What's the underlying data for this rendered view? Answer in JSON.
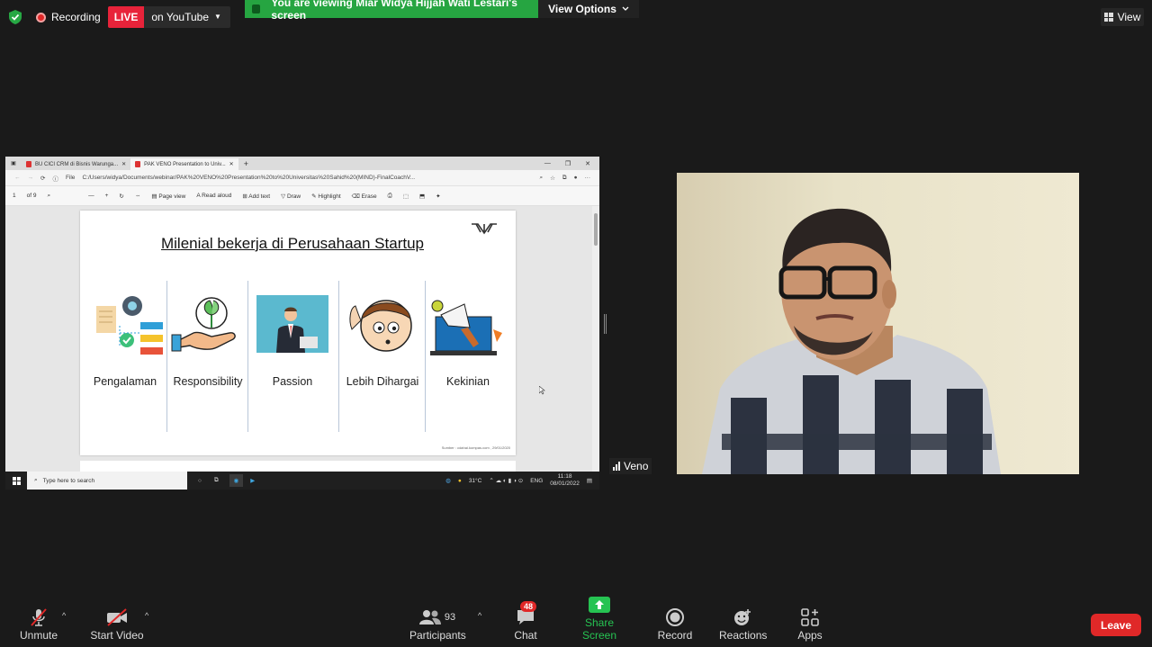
{
  "top": {
    "recording_label": "Recording",
    "live_label": "LIVE",
    "youtube_label": "on YouTube",
    "viewing_banner": "You are viewing Miar Widya Hijjah Wati Lestari's screen",
    "view_options_label": "View Options",
    "view_label": "View"
  },
  "browser": {
    "tabs": [
      {
        "label": "BU CICI CRM di Bisnis Warunga..."
      },
      {
        "label": "PAK VENO Presentation to Univ..."
      }
    ],
    "address_prefix": "File",
    "url": "C:/Users/widya/Documents/webinar/PAK%20VENO%20Presentation%20to%20Universitas%20Sahid%20(MIND)-FinalCoachV...",
    "page_number": "1",
    "page_total": "of 9",
    "toolbar": {
      "page_view": "Page view",
      "read_aloud": "Read aloud",
      "add_text": "Add text",
      "draw": "Draw",
      "highlight": "Highlight",
      "erase": "Erase"
    }
  },
  "slide": {
    "title": "Milenial bekerja di Perusahaan Startup",
    "items": [
      {
        "label": "Pengalaman"
      },
      {
        "label": "Responsibility"
      },
      {
        "label": "Passion"
      },
      {
        "label": "Lebih Dihargai"
      },
      {
        "label": "Kekinian"
      }
    ],
    "source": "Sumber : cdahai.kompas.com , 29/01/2020"
  },
  "taskbar": {
    "search_placeholder": "Type here to search",
    "temperature": "31°C",
    "language": "ENG",
    "time": "11:18",
    "date": "08/01/2022"
  },
  "participant": {
    "name": "Veno"
  },
  "controls": {
    "unmute": "Unmute",
    "start_video": "Start Video",
    "participants": "Participants",
    "participant_count": "93",
    "chat": "Chat",
    "chat_badge": "48",
    "share_screen": "Share Screen",
    "record": "Record",
    "reactions": "Reactions",
    "apps": "Apps",
    "leave": "Leave"
  },
  "colors": {
    "live_red": "#e8233a",
    "banner_green": "#26a541",
    "share_green": "#26c352",
    "leave_red": "#e02828"
  }
}
